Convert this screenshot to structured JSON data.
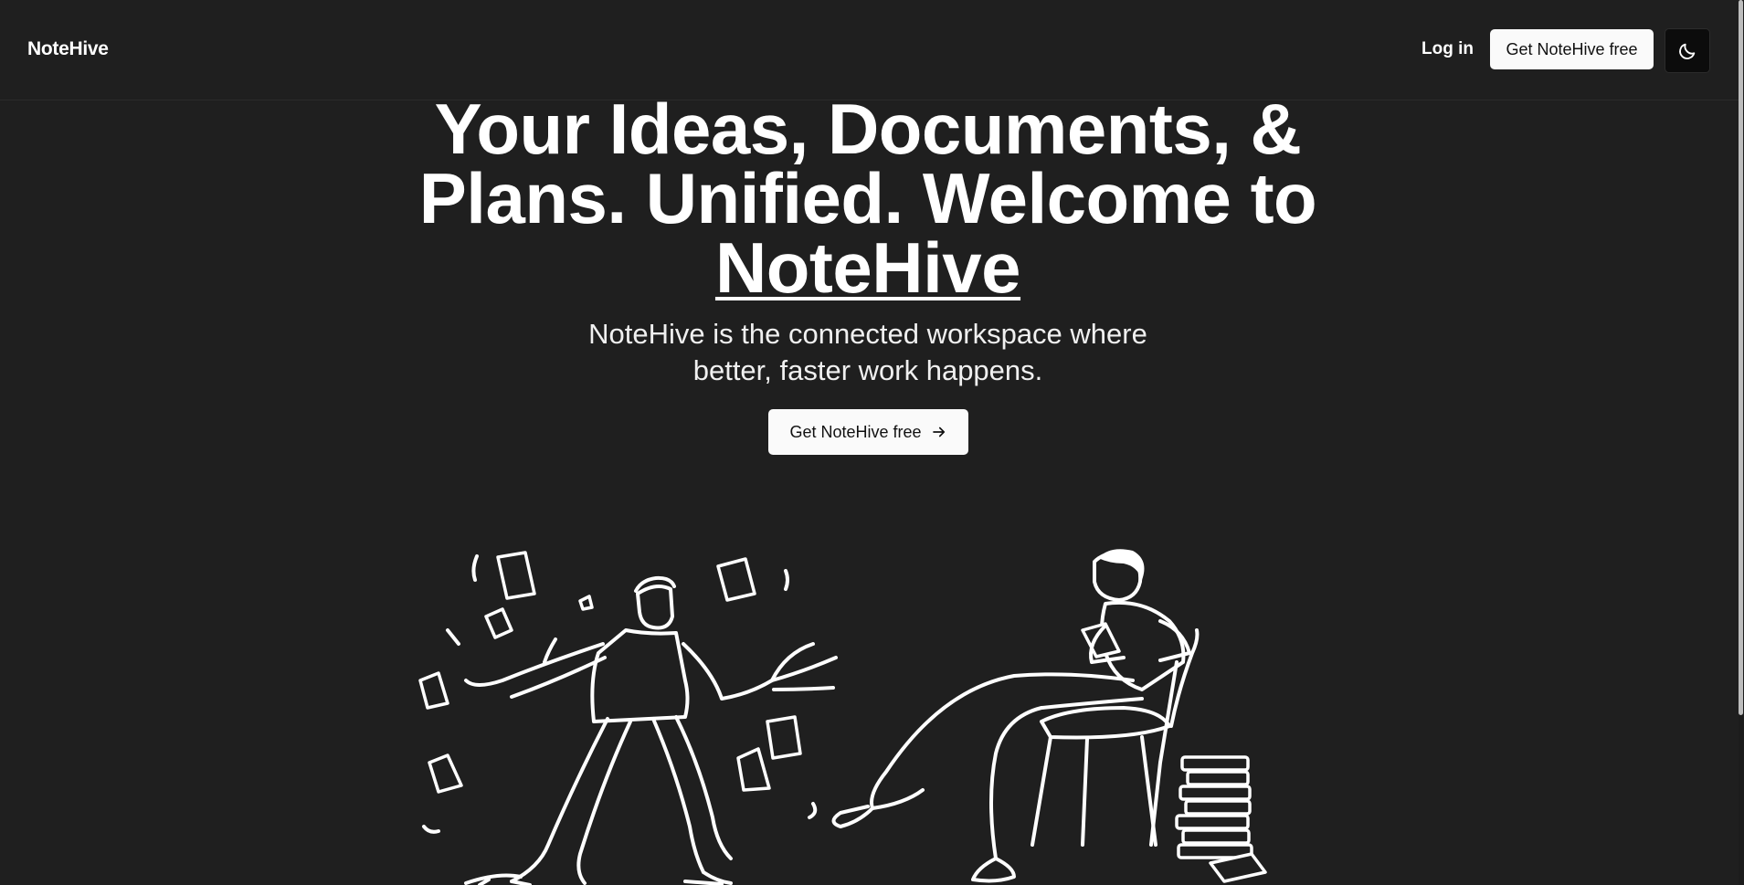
{
  "brand": "NoteHive",
  "nav": {
    "login_label": "Log in",
    "cta_label": "Get NoteHive free",
    "theme_icon": "moon-icon"
  },
  "hero": {
    "title_part1": "Your Ideas, Documents, & Plans. Unified. Welcome to ",
    "title_brand": "NoteHive",
    "subtitle": "NoteHive is the connected workspace where better, faster work happens.",
    "cta_label": "Get NoteHive free",
    "cta_icon": "arrow-right-icon"
  },
  "colors": {
    "background": "#1f1f1f",
    "text": "#ffffff",
    "button_bg": "#fafafa",
    "button_text": "#111111",
    "toggle_bg": "#0c0c0c"
  }
}
